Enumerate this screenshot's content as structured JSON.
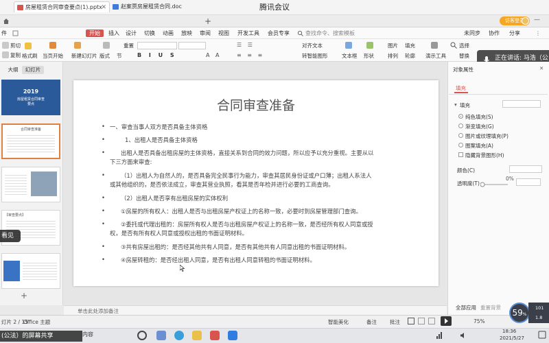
{
  "meeting": {
    "title": "腾讯会议"
  },
  "tabs": [
    {
      "label": "房屋租赁合同审查要点(1).pptx",
      "color": "#d9534f"
    },
    {
      "label": "赵案贾房屋租赁合同.doc",
      "color": "#3f7ad9"
    }
  ],
  "topright": {
    "login": "访客登录"
  },
  "menu": {
    "file": "件",
    "items": [
      "开始",
      "插入",
      "设计",
      "切换",
      "动画",
      "放映",
      "审阅",
      "视图",
      "开发工具",
      "会员专享"
    ],
    "search": "查找命令、搜索模板",
    "right": [
      "未同步",
      "协作",
      "分享"
    ]
  },
  "toolbar": {
    "cut": "剪切",
    "copy": "复制",
    "format_painter": "格式刷",
    "from_current": "当页开始",
    "new_slide": "新建幻灯片",
    "layout": "版式",
    "section": "节",
    "reset": "重置",
    "text_box": "文本框",
    "shape": "形状",
    "arrange": "排列",
    "picture": "图片",
    "fill": "填充",
    "outline": "轮廓",
    "presentation_tools": "演示工具",
    "replace": "替换",
    "select": "选择",
    "align_text": "对齐文本",
    "convert_smartart": "转智能图形"
  },
  "speaker": {
    "label": "正在讲话: 马浩（公"
  },
  "left_panel": {
    "tabs": [
      "大纲",
      "幻灯片"
    ],
    "thumb1": {
      "year": "2019",
      "line1": "房屋租赁合同审查",
      "line2": "要点"
    },
    "thumb2_title": "合同审查准备",
    "thumb4_title": "【审查要点】",
    "add": "+"
  },
  "viewer_label": "看见",
  "slide": {
    "title": "合同审查准备",
    "lines": [
      "一、审查当事人双方是否具备主体资格",
      "1、出租人是否具备主体资格",
      "出租人是否具备出租房屋的主体资格，直接关系到合同的效力问题，所以应予以充分重视。主要从以",
      "下三方面来审查:",
      "（1）出租人为自然人的，是否具备完全民事行为能力，审查其居民身份证或户口薄；出租人系法人",
      "或其他组织的，是否依法成立，审查其营业执照，看其是否年检并进行必要的工商查询。",
      "（2）出租人是否享有出租房屋的实体权利",
      "①房屋的所有权人：出租人是否与出租房屋产权证上的名称一致，必要时到房屋管理部门查询。",
      "②委托或代理出租的：房屋所有权人是否与出租房屋产权证上的名称一致，是否经所有权人同意或授",
      "权，是否有所有权人同意或授权出租的书面证明材料。",
      "③共有房屋出租的：是否经其他共有人同意，是否有其他共有人同意出租的书面证明材料。",
      "④房屋转租的：是否经出租人同意，是否有出租人同意转租的书面证明材料。"
    ],
    "bullet": "•"
  },
  "notes": {
    "placeholder": "单击此处添加备注"
  },
  "right_panel": {
    "header": "对象属性",
    "tab": "填充",
    "section": "填充",
    "options": [
      "纯色填充(S)",
      "渐变填充(G)",
      "图片或纹理填充(P)",
      "图案填充(A)"
    ],
    "hide_bg": "隐藏背景图形(H)",
    "color_label": "颜色(C)",
    "transparency_label": "透明度(T)",
    "transparency_value": "0%",
    "apply_all": "全部应用",
    "reset_bg": "重置背景"
  },
  "status": {
    "slide_info": "灯片 2 / 15",
    "theme": "Office 主题",
    "smart_beautify": "智能美化",
    "notes": "备注",
    "comments": "批注",
    "zoom": "75%"
  },
  "perf": {
    "value": "59",
    "unit": "%"
  },
  "net": {
    "up": "101",
    "down": "1.8"
  },
  "taskbar": {
    "caption": "(公法）的屏幕共享",
    "search_text": "内容",
    "time": "18:36",
    "date": "2021/5/27"
  }
}
